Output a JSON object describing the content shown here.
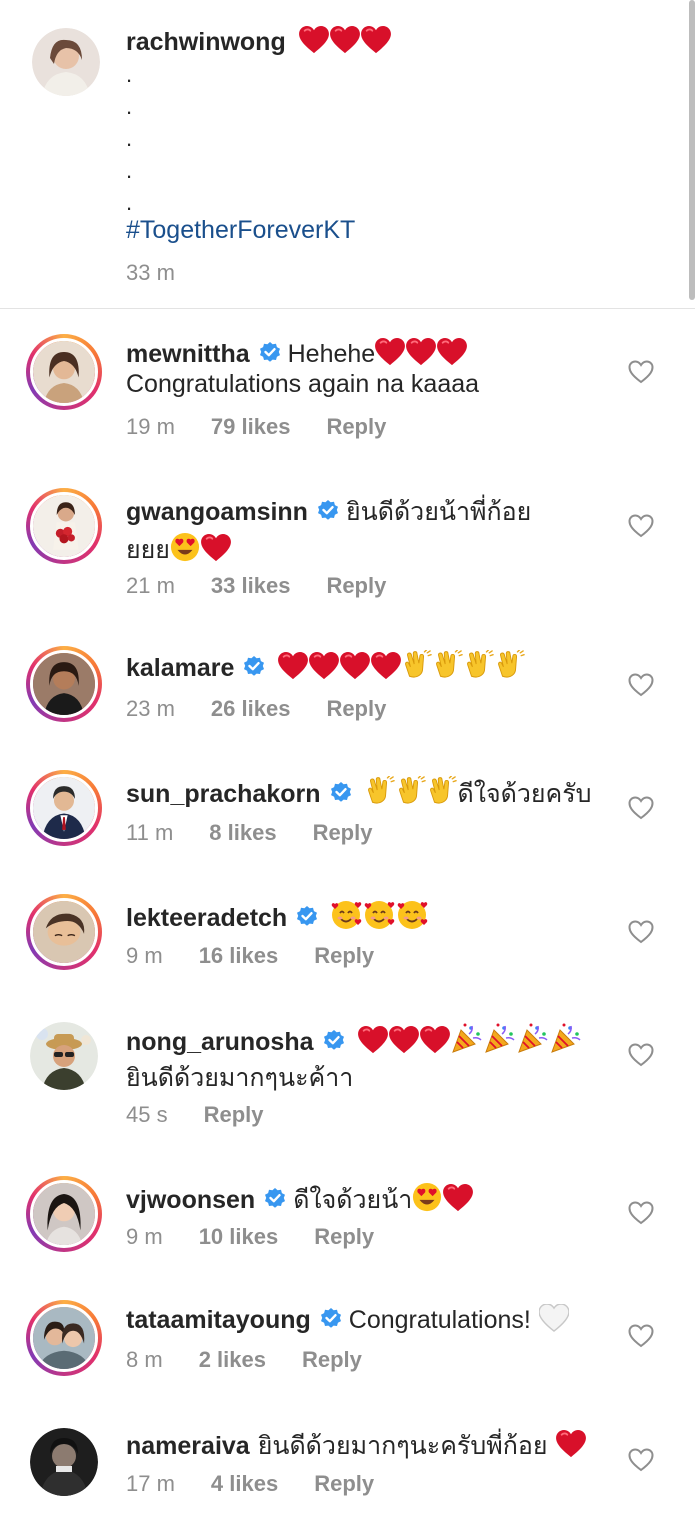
{
  "caption": {
    "username": "rachwinwong",
    "dots": [
      ".",
      ".",
      ".",
      ".",
      "."
    ],
    "hashtag": "#TogetherForeverKT",
    "time": "33 m",
    "reactions": [
      "red-heart",
      "red-heart",
      "red-heart"
    ]
  },
  "comments": [
    {
      "username": "mewnittha",
      "verified": true,
      "text1": "Hehehe",
      "emojis1": [
        "red-heart",
        "red-heart",
        "red-heart"
      ],
      "text2": "Congratulations again na kaaaa",
      "time": "19 m",
      "likes": "79 likes",
      "reply": "Reply"
    },
    {
      "username": "gwangoamsinn",
      "verified": true,
      "text1": "ยินดีด้วยน้าพี่ก้อย",
      "text2": "ยยย",
      "emojis2": [
        "heart-eyes",
        "red-heart"
      ],
      "time": "21 m",
      "likes": "33 likes",
      "reply": "Reply"
    },
    {
      "username": "kalamare",
      "verified": true,
      "text1": "",
      "emojis1": [
        "red-heart",
        "red-heart",
        "red-heart",
        "red-heart",
        "clap",
        "clap",
        "clap",
        "clap"
      ],
      "time": "23 m",
      "likes": "26 likes",
      "reply": "Reply"
    },
    {
      "username": "sun_prachakorn",
      "verified": true,
      "emojis1": [
        "clap",
        "clap",
        "clap"
      ],
      "text1": "ดีใจด้วยครับ",
      "time": "11 m",
      "likes": "8 likes",
      "reply": "Reply"
    },
    {
      "username": "lekteeradetch",
      "verified": true,
      "emojis1": [
        "smiling-hearts",
        "smiling-hearts",
        "smiling-hearts"
      ],
      "time": "9 m",
      "likes": "16 likes",
      "reply": "Reply"
    },
    {
      "username": "nong_arunosha",
      "verified": true,
      "emojis1": [
        "red-heart",
        "red-heart",
        "red-heart",
        "party-popper",
        "party-popper",
        "party-popper",
        "party-popper"
      ],
      "text2": "ยินดีด้วยมากๆนะค้าา",
      "time": "45 s",
      "likes": "",
      "reply": "Reply"
    },
    {
      "username": "vjwoonsen",
      "verified": true,
      "text1": "ดีใจด้วยน้า",
      "emojis1": [
        "heart-eyes",
        "red-heart"
      ],
      "time": "9 m",
      "likes": "10 likes",
      "reply": "Reply"
    },
    {
      "username": "tataamitayoung",
      "verified": true,
      "text1": "Congratulations!",
      "emojis1": [
        "white-heart"
      ],
      "time": "8 m",
      "likes": "2 likes",
      "reply": "Reply"
    },
    {
      "username": "nameraiva",
      "verified": false,
      "text1": "ยินดีด้วยมากๆนะครับพี่ก้อย",
      "emojis1": [
        "red-heart"
      ],
      "time": "17 m",
      "likes": "4 likes",
      "reply": "Reply"
    }
  ],
  "icons": {
    "like": "heart-outline-icon",
    "verified": "verified-badge-icon"
  },
  "colors": {
    "link": "#1a4f8c",
    "verified": "#3897f0",
    "meta": "#8e8e8e",
    "heart": "#e0102a"
  }
}
